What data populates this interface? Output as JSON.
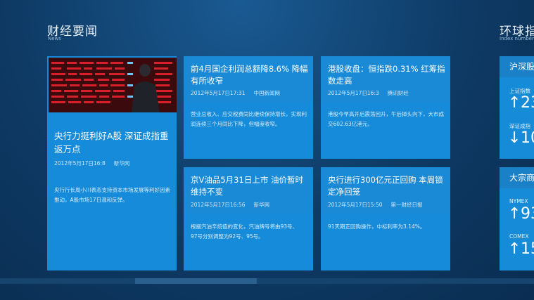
{
  "news": {
    "title": "财经要闻",
    "subtitle": "News"
  },
  "index_section": {
    "title": "环球指",
    "subtitle": "Index number"
  },
  "featured": {
    "title": "央行力挺利好A股 深证成指重返万点",
    "date": "2012年5月17日16:8",
    "source": "新华网",
    "summary": "央行行长周小川表态支持资本市场发展等利好因素推动，A股市场17日温和反弹。"
  },
  "tiles": [
    {
      "title": "前4月国企利润总额降8.6% 降幅有所收窄",
      "date": "2012年5月17日17:31",
      "source": "中国新闻网",
      "summary": "营业总收入、应交税费同比继续保持增长，实现利润连续三个月同比下降，但幅度收窄。"
    },
    {
      "title": "港股收盘：恒指跌0.31% 红筹指数走高",
      "date": "2012年5月17日16:3",
      "source": "腾讯财经",
      "summary": "港股今早高开后震荡回升，午后掉头向下，大市成交602.63亿港元。"
    },
    {
      "title": "京V油品5月31日上市 油价暂时维持不变",
      "date": "2012年5月17日16:56",
      "source": "新华网",
      "summary": "根据汽油辛烷值的变化，汽油牌号将由93号、97号分别调整为92号、95号。"
    },
    {
      "title": "央行进行300亿元正回购 本周锁定净回笼",
      "date": "2012年5月17日15:50",
      "source": "第一财经日报",
      "summary": "91天期正回购操作，中标利率为3.14%。"
    }
  ],
  "indices": {
    "hushen": {
      "title": "沪深股",
      "items": [
        {
          "label": "上证指数",
          "value": "23",
          "arrow": "↑",
          "direction": "up"
        },
        {
          "label": "深证成指",
          "value": "10",
          "arrow": "↓",
          "direction": "down"
        }
      ]
    },
    "commodity": {
      "title": "大宗商",
      "items": [
        {
          "label": "NYMEX",
          "value": "93",
          "arrow": "↑",
          "direction": "up"
        },
        {
          "label": "COMEX",
          "value": "15",
          "arrow": "↑",
          "direction": "up"
        }
      ]
    }
  }
}
